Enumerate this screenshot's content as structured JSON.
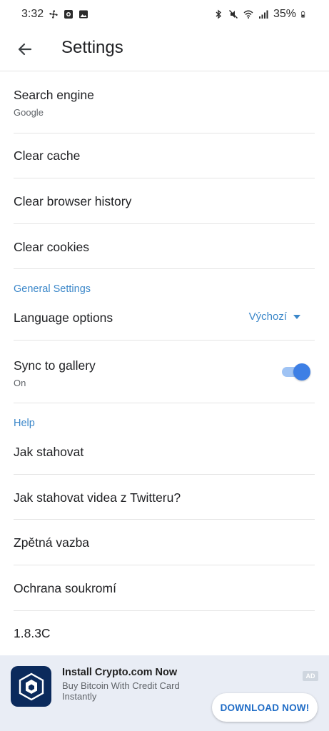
{
  "status_bar": {
    "time": "3:32",
    "battery": "35%",
    "left_icons": [
      "fan-icon",
      "camera-app-icon",
      "gallery-icon"
    ],
    "right_icons": [
      "bluetooth-icon",
      "mute-icon",
      "wifi-icon",
      "signal-icon",
      "battery-icon"
    ]
  },
  "app_bar": {
    "title": "Settings",
    "back_icon": "arrow-left-icon"
  },
  "items": {
    "search_engine": {
      "label": "Search engine",
      "value": "Google"
    },
    "clear_cache": {
      "label": "Clear cache"
    },
    "clear_history": {
      "label": "Clear browser history"
    },
    "clear_cookies": {
      "label": "Clear cookies"
    }
  },
  "general": {
    "header": "General Settings",
    "language": {
      "label": "Language options",
      "value": "Výchozí"
    },
    "sync": {
      "label": "Sync to gallery",
      "value": "On",
      "enabled": true
    }
  },
  "help": {
    "header": "Help",
    "items": [
      "Jak stahovat",
      "Jak stahovat videa z Twitteru?",
      "Zpětná vazba",
      "Ochrana soukromí",
      "1.8.3C"
    ]
  },
  "ad": {
    "title": "Install Crypto.com Now",
    "text": "Buy Bitcoin With Credit Card Instantly",
    "badge": "AD",
    "button": "DOWNLOAD NOW!"
  },
  "colors": {
    "accent": "#3b87c9",
    "toggle_on": "#3d7fe5",
    "ad_background": "#e9edf5",
    "ad_logo": "#0b2a5c"
  }
}
